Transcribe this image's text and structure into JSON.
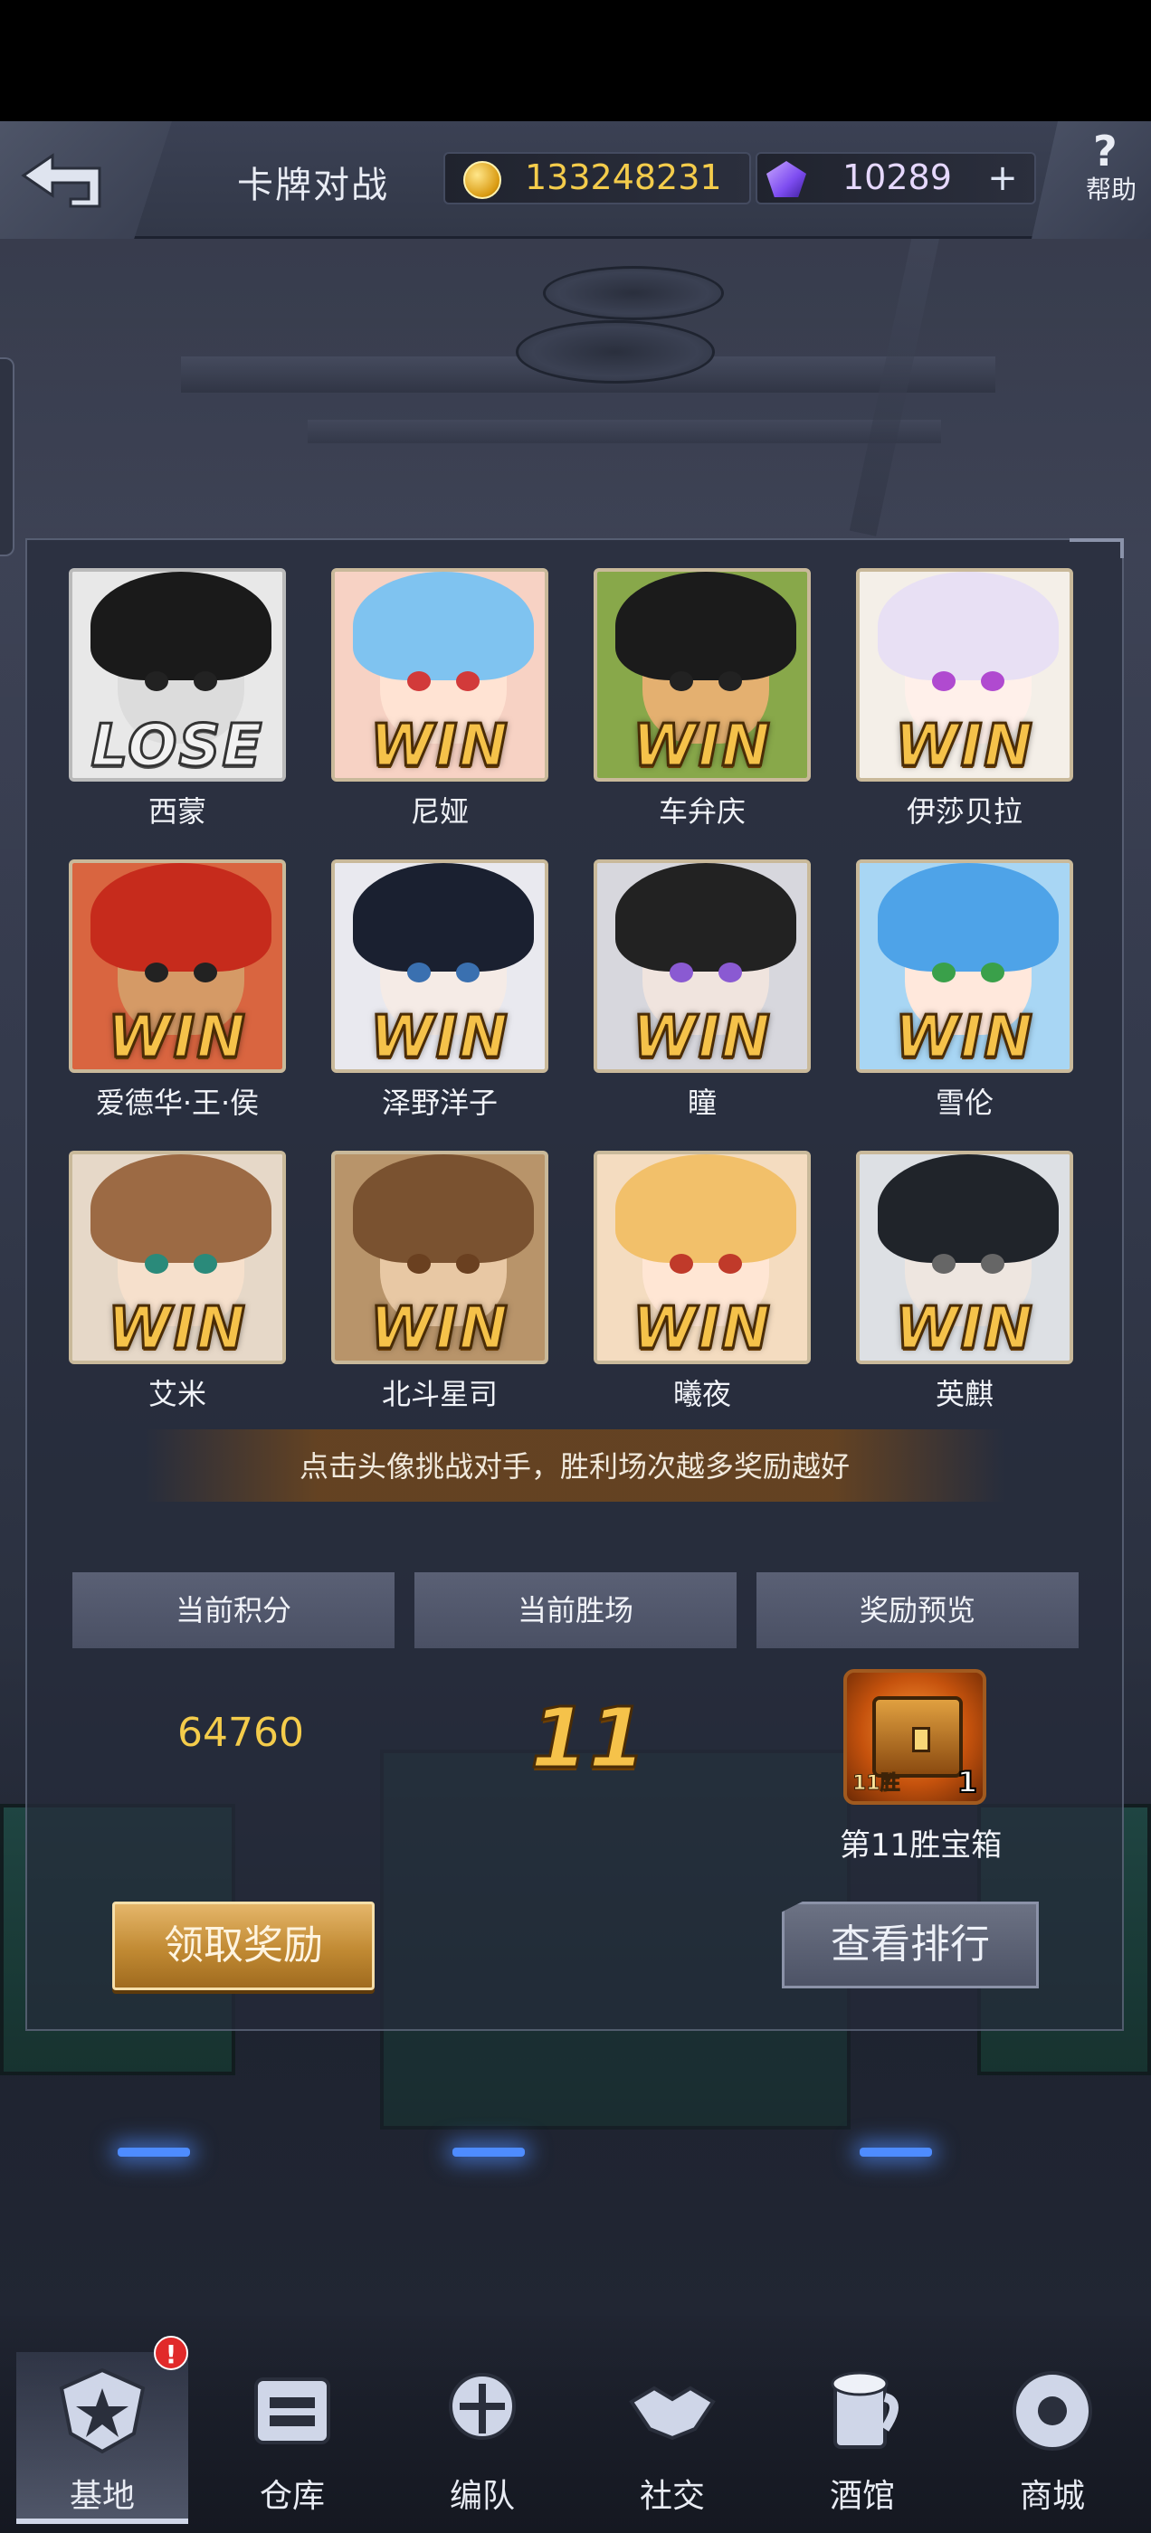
{
  "header": {
    "title": "卡牌对战",
    "coins": "133248231",
    "gems": "10289",
    "plus": "+",
    "help_symbol": "?",
    "help_label": "帮助"
  },
  "opponents": [
    {
      "name": "西蒙",
      "result": "LOSE"
    },
    {
      "name": "尼娅",
      "result": "WIN"
    },
    {
      "name": "车弁庆",
      "result": "WIN"
    },
    {
      "name": "伊莎贝拉",
      "result": "WIN"
    },
    {
      "name": "爱德华·王·侯",
      "result": "WIN"
    },
    {
      "name": "泽野洋子",
      "result": "WIN"
    },
    {
      "name": "瞳",
      "result": "WIN"
    },
    {
      "name": "雪伦",
      "result": "WIN"
    },
    {
      "name": "艾米",
      "result": "WIN"
    },
    {
      "name": "北斗星司",
      "result": "WIN"
    },
    {
      "name": "曦夜",
      "result": "WIN"
    },
    {
      "name": "英麒",
      "result": "WIN"
    }
  ],
  "hint": "点击头像挑战对手，胜利场次越多奖励越好",
  "stats": {
    "score_label": "当前积分",
    "wins_label": "当前胜场",
    "reward_label": "奖励预览",
    "score": "64760",
    "wins": "11",
    "reward_name": "第11胜宝箱",
    "reward_count": "1",
    "reward_tag": "11胜"
  },
  "buttons": {
    "claim": "领取奖励",
    "ranking": "查看排行"
  },
  "nav": [
    {
      "label": "基地",
      "icon": "base-icon",
      "active": true
    },
    {
      "label": "仓库",
      "icon": "warehouse-icon"
    },
    {
      "label": "编队",
      "icon": "formation-icon"
    },
    {
      "label": "社交",
      "icon": "handshake-icon"
    },
    {
      "label": "酒馆",
      "icon": "tavern-icon"
    },
    {
      "label": "商城",
      "icon": "shop-icon"
    }
  ],
  "nav_alert": "!",
  "colors": {
    "win_gold": "#f5c24a",
    "coin_text": "#f4cc4b"
  }
}
